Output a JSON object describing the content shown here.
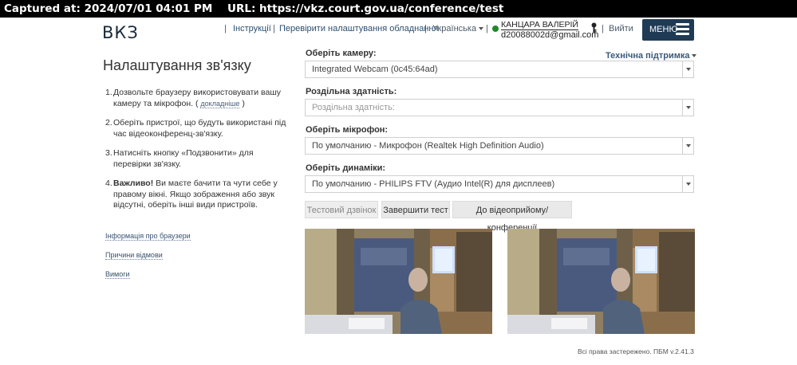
{
  "capture": {
    "captured_at": "Captured at: 2024/07/01 04:01 PM",
    "url": "URL: https://vkz.court.gov.ua/conference/test"
  },
  "header": {
    "logo": "ВКЗ",
    "sep": "|",
    "nav_instructions": "Інструкції",
    "nav_check": "Перевірити налаштування обладнання",
    "language": "Українська",
    "user_name": "КАНЦАРА ВАЛЕРІЙ",
    "user_email": "d20088002d@gmail.com",
    "logout": "Вийти",
    "menu": "МЕНЮ",
    "user_status_color": "#1e8a2a",
    "accent_color": "#1f3a54"
  },
  "left": {
    "title": "Налаштування зв'язку",
    "steps": [
      {
        "num": "1.",
        "text": "Дозвольте браузеру використовувати вашу камеру та мікрофон. (",
        "link": "докладніше",
        "tail": ")"
      },
      {
        "num": "2.",
        "text": "Оберіть пристрої, що будуть використані під час відеоконференц-зв'язку."
      },
      {
        "num": "3.",
        "text": "Натисніть кнопку «Подзвонити» для перевірки зв'язку."
      },
      {
        "num": "4.",
        "bold": "Важливо!",
        "text": " Ви маєте бачити та чути себе у правому вікні. Якщо зображення або звук відсутні, оберіть інші види пристроїв."
      }
    ],
    "links": [
      "Інформація про браузери",
      "Причини відмови",
      "Вимоги"
    ]
  },
  "form": {
    "support": "Технічна підтримка",
    "camera_label": "Оберіть камеру:",
    "camera_value": "Integrated Webcam (0c45:64ad)",
    "resolution_label": "Роздільна здатність:",
    "resolution_placeholder": "Роздільна здатність:",
    "mic_label": "Оберіть мікрофон:",
    "mic_value": "По умолчанию - Микрофон (Realtek High Definition Audio)",
    "speaker_label": "Оберіть динаміки:",
    "speaker_value": "По умолчанию - PHILIPS FTV (Аудио Intel(R) для дисплеев)",
    "btn_test_call": "Тестовий дзвінок",
    "btn_end_test": "Завершити тест",
    "btn_to_conference": "До відеоприйому/конференції"
  },
  "footer": {
    "text": "Всі права застережено. ПБМ v.2.41.3"
  }
}
